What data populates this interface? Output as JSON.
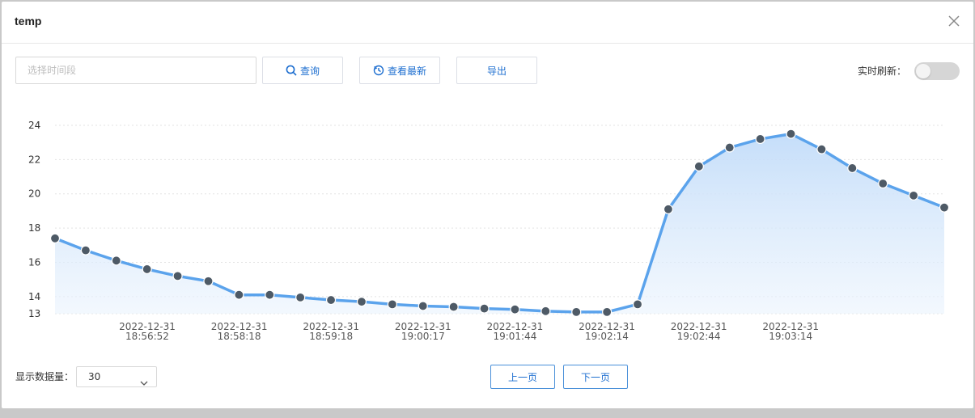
{
  "dialog": {
    "title": "temp"
  },
  "toolbar": {
    "range_placeholder": "选择时间段",
    "query_label": "查询",
    "latest_label": "查看最新",
    "export_label": "导出",
    "realtime_label": "实时刷新：",
    "realtime_on": false
  },
  "footer": {
    "count_label": "显示数据量：",
    "count_value": "30",
    "prev_label": "上一页",
    "next_label": "下一页"
  },
  "colors": {
    "line": "#5ba3ec",
    "point": "#4e5a66",
    "accent": "#1e6fd0"
  },
  "chart_data": {
    "type": "area",
    "y_ticks": [
      13,
      14,
      16,
      18,
      20,
      22,
      24
    ],
    "ylim": [
      13,
      24
    ],
    "x_tick_labels": [
      [
        "2022-12-31",
        "18:56:52"
      ],
      [
        "2022-12-31",
        "18:58:18"
      ],
      [
        "2022-12-31",
        "18:59:18"
      ],
      [
        "2022-12-31",
        "19:00:17"
      ],
      [
        "2022-12-31",
        "19:01:44"
      ],
      [
        "2022-12-31",
        "19:02:14"
      ],
      [
        "2022-12-31",
        "19:02:44"
      ],
      [
        "2022-12-31",
        "19:03:14"
      ]
    ],
    "grid": true,
    "series": [
      {
        "values": [
          17.4,
          16.7,
          16.1,
          15.6,
          15.2,
          14.9,
          14.1,
          14.1,
          13.95,
          13.8,
          13.7,
          13.55,
          13.45,
          13.4,
          13.3,
          13.25,
          13.15,
          13.1,
          13.1,
          13.55,
          19.1,
          21.6,
          22.7,
          23.2,
          23.5,
          22.6,
          21.5,
          20.6,
          19.9,
          19.2
        ]
      }
    ]
  }
}
